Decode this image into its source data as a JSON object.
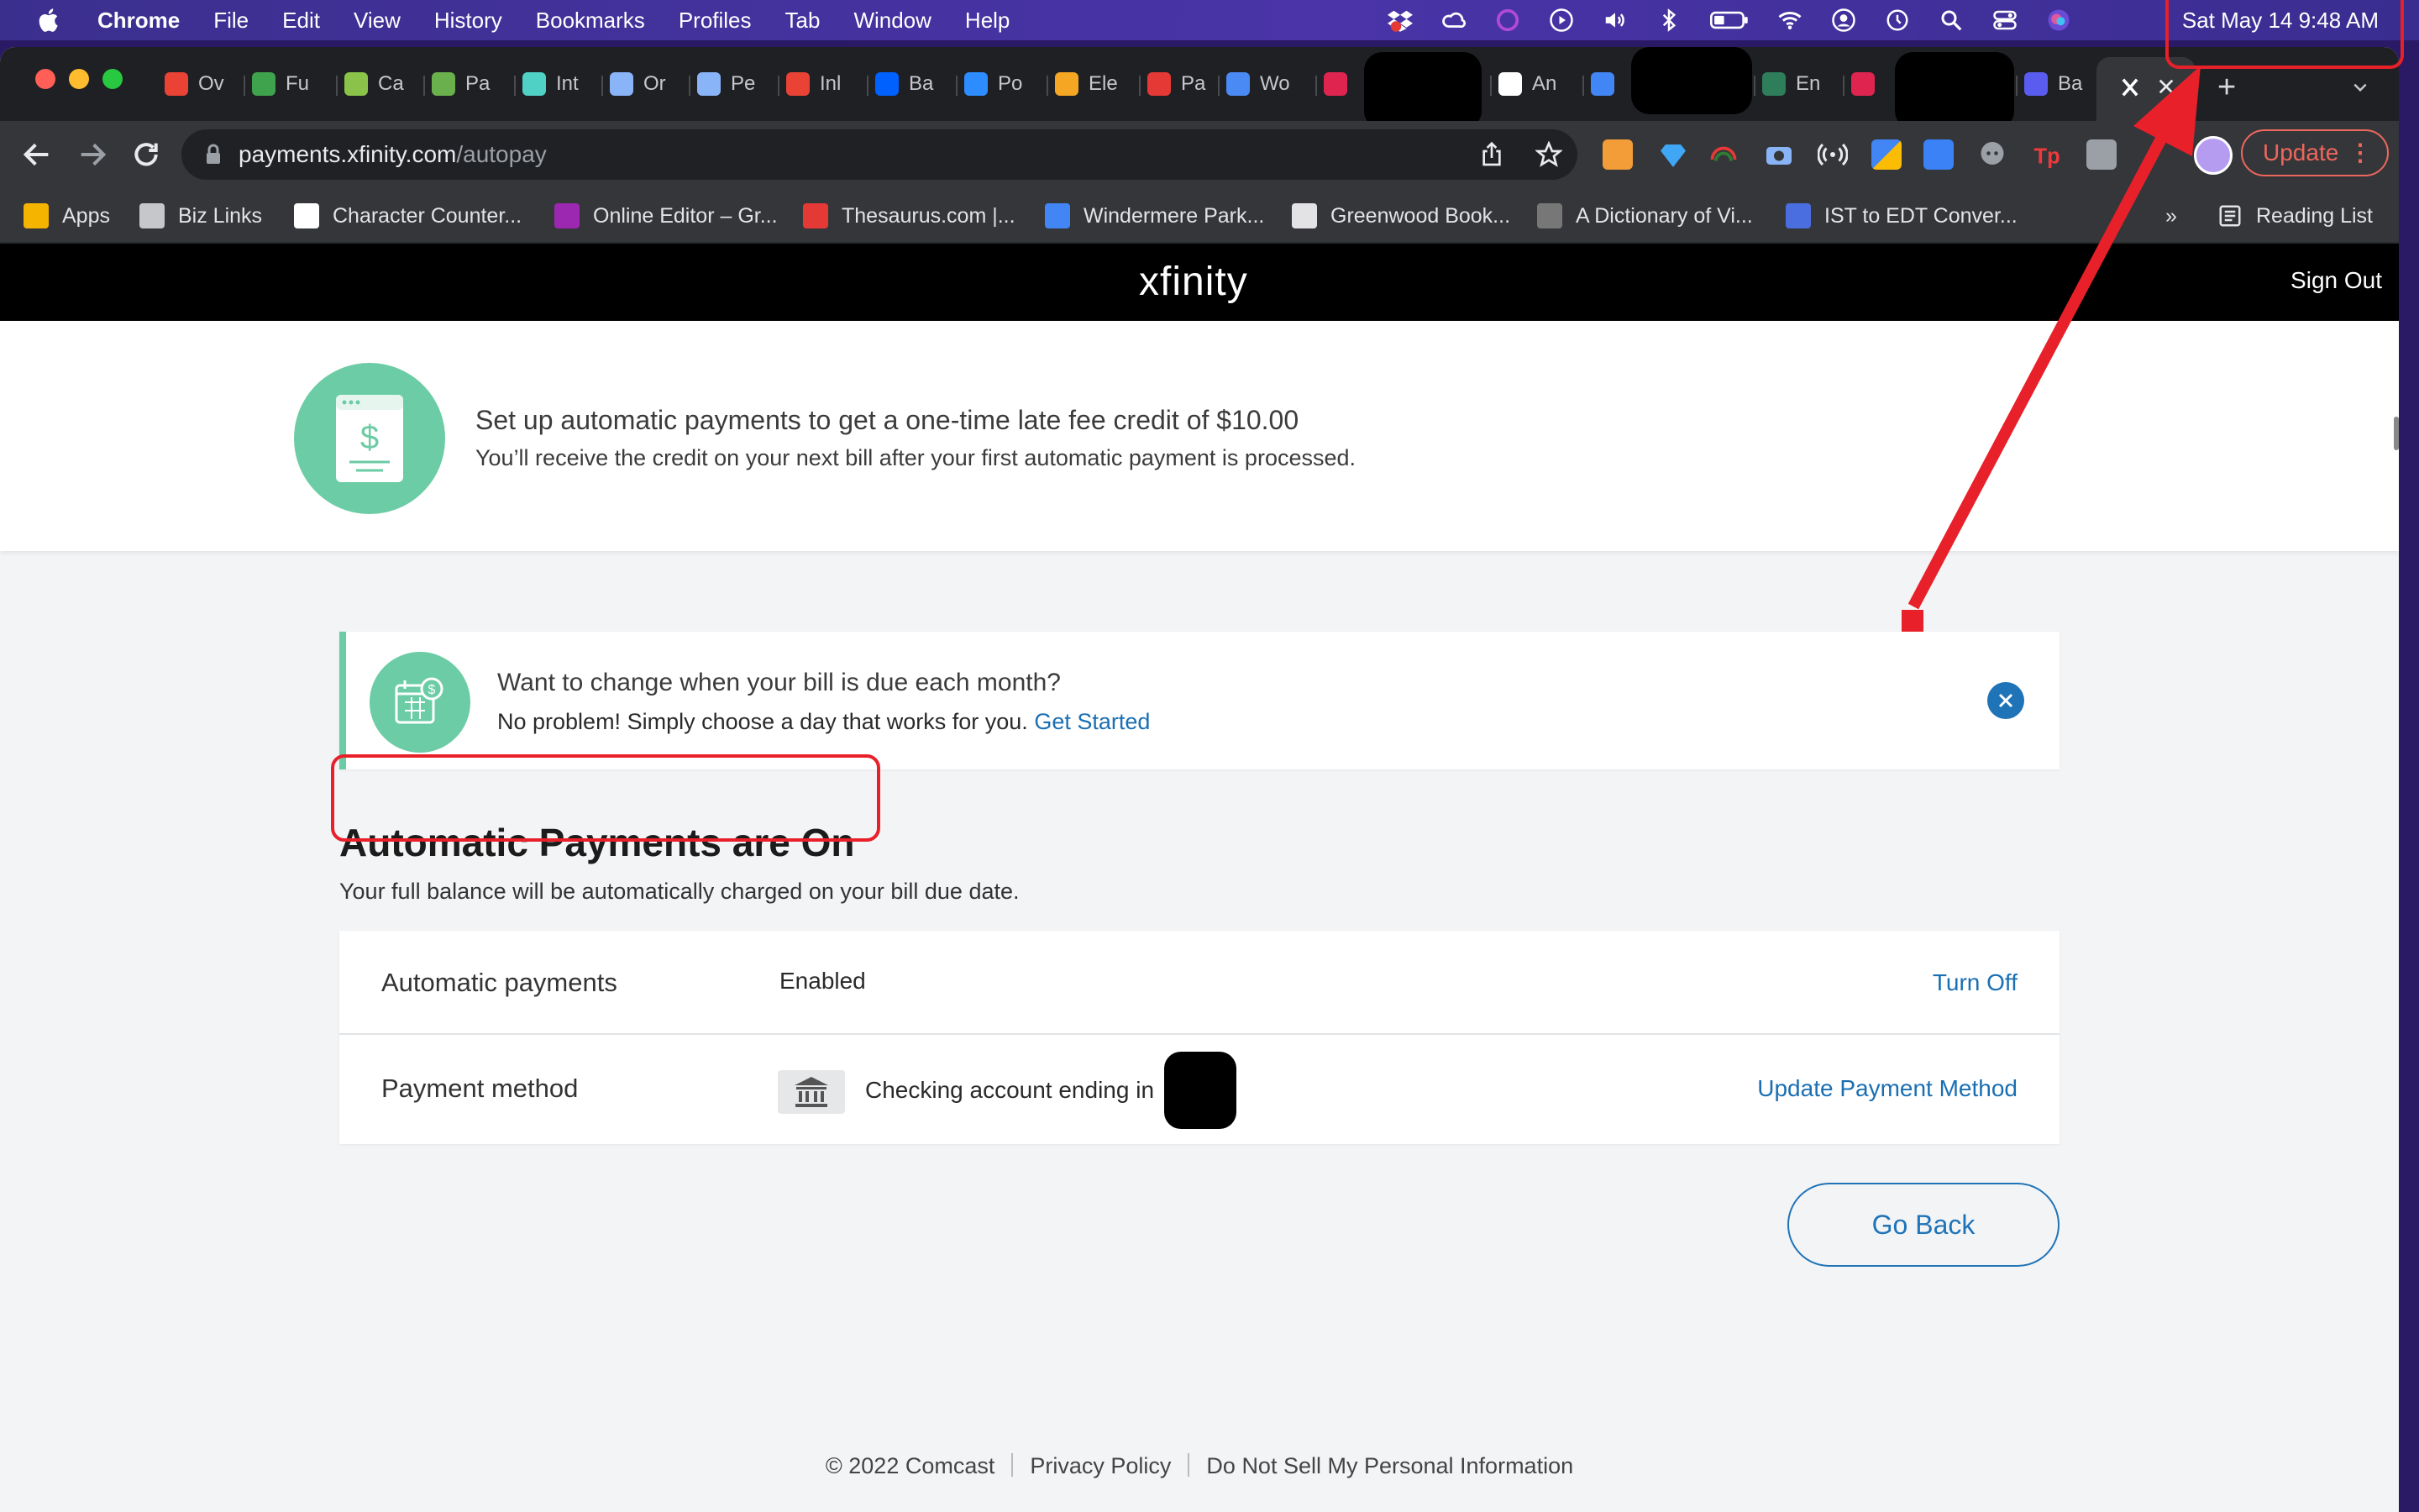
{
  "menubar": {
    "app_name": "Chrome",
    "menus": [
      "File",
      "Edit",
      "View",
      "History",
      "Bookmarks",
      "Profiles",
      "Tab",
      "Window",
      "Help"
    ],
    "clock": "Sat May 14  9:48 AM"
  },
  "tabs": [
    {
      "label": "Ov",
      "icon": "gmail-icon",
      "color": "#ea4335"
    },
    {
      "label": "Fu",
      "icon": "leaf-icon",
      "color": "#3fa34d"
    },
    {
      "label": "Ca",
      "icon": "c-icon",
      "color": "#8bc34a"
    },
    {
      "label": "Pa",
      "icon": "plant-icon",
      "color": "#6ab04c"
    },
    {
      "label": "Int",
      "icon": "snowflake-icon",
      "color": "#4fd1c5"
    },
    {
      "label": "Or",
      "icon": "glasses-icon",
      "color": "#8ab4f8"
    },
    {
      "label": "Pe",
      "icon": "glasses-icon",
      "color": "#8ab4f8"
    },
    {
      "label": "Inl",
      "icon": "gmail-icon",
      "color": "#ea4335"
    },
    {
      "label": "Ba",
      "icon": "dropbox-icon",
      "color": "#0061fe"
    },
    {
      "label": "Po",
      "icon": "zoom-icon",
      "color": "#2d8cff"
    },
    {
      "label": "Ele",
      "icon": "pencil-icon",
      "color": "#f5a623"
    },
    {
      "label": "Pa",
      "icon": "bars-icon",
      "color": "#e53935"
    },
    {
      "label": "Wo",
      "icon": "grid-icon",
      "color": "#4a8af4"
    },
    {
      "label": "",
      "icon": "m-icon",
      "color": "#e02450"
    },
    {
      "label": "An",
      "icon": "amazon-icon",
      "color": "#ffffff"
    },
    {
      "label": "",
      "icon": "docs-icon",
      "color": "#4285f4"
    },
    {
      "label": "En",
      "icon": "f-icon",
      "color": "#2e7d5b"
    },
    {
      "label": "",
      "icon": "m-icon",
      "color": "#e02450"
    },
    {
      "label": "Ba",
      "icon": "w-icon",
      "color": "#5a5cf0"
    },
    {
      "label": "",
      "icon": "xfinity-x-icon",
      "color": "#ffffff"
    }
  ],
  "toolbar": {
    "url_host": "payments.xfinity.com",
    "url_path": "/autopay",
    "update_label": "Update",
    "update_dots": "⋮"
  },
  "bookmarks": [
    {
      "label": "Apps",
      "icon": "apps-grid-icon"
    },
    {
      "label": "Biz Links",
      "icon": "folder-icon"
    },
    {
      "label": "Character Counter...",
      "icon": "w-icon"
    },
    {
      "label": "Online Editor – Gr...",
      "icon": "colorgrid-icon"
    },
    {
      "label": "Thesaurus.com |...",
      "icon": "t-icon"
    },
    {
      "label": "Windermere Park...",
      "icon": "plane-icon"
    },
    {
      "label": "Greenwood Book...",
      "icon": "globe-icon"
    },
    {
      "label": "A Dictionary of Vi...",
      "icon": "eye-icon"
    },
    {
      "label": "IST to EDT Conver...",
      "icon": "clock-icon"
    }
  ],
  "bookmarks_more": "»",
  "reading_list": "Reading List",
  "site": {
    "logo": "xfinity",
    "sign_out": "Sign Out"
  },
  "promo": {
    "title": "Set up automatic payments to get a one-time late fee credit of $10.00",
    "subtitle": "You’ll receive the credit on your next bill after your first automatic payment is processed."
  },
  "notice": {
    "title": "Want to change when your bill is due each month?",
    "subtitle": "No problem! Simply choose a day that works for you.",
    "link": "Get Started"
  },
  "autopay": {
    "title": "Automatic Payments are On",
    "description": "Your full balance will be automatically charged on your bill due date.",
    "rows": [
      {
        "label": "Automatic payments",
        "value": "Enabled",
        "action": "Turn Off"
      },
      {
        "label": "Payment method",
        "value": "Checking account ending in",
        "action": "Update Payment Method"
      }
    ],
    "go_back": "Go Back"
  },
  "footer": {
    "copyright": "© 2022 Comcast",
    "privacy": "Privacy Policy",
    "do_not_sell": "Do Not Sell My Personal Information"
  },
  "colors": {
    "xfinity_green": "#6bcca5",
    "link_blue": "#1a6fb3",
    "annotation_red": "#e8202a"
  }
}
